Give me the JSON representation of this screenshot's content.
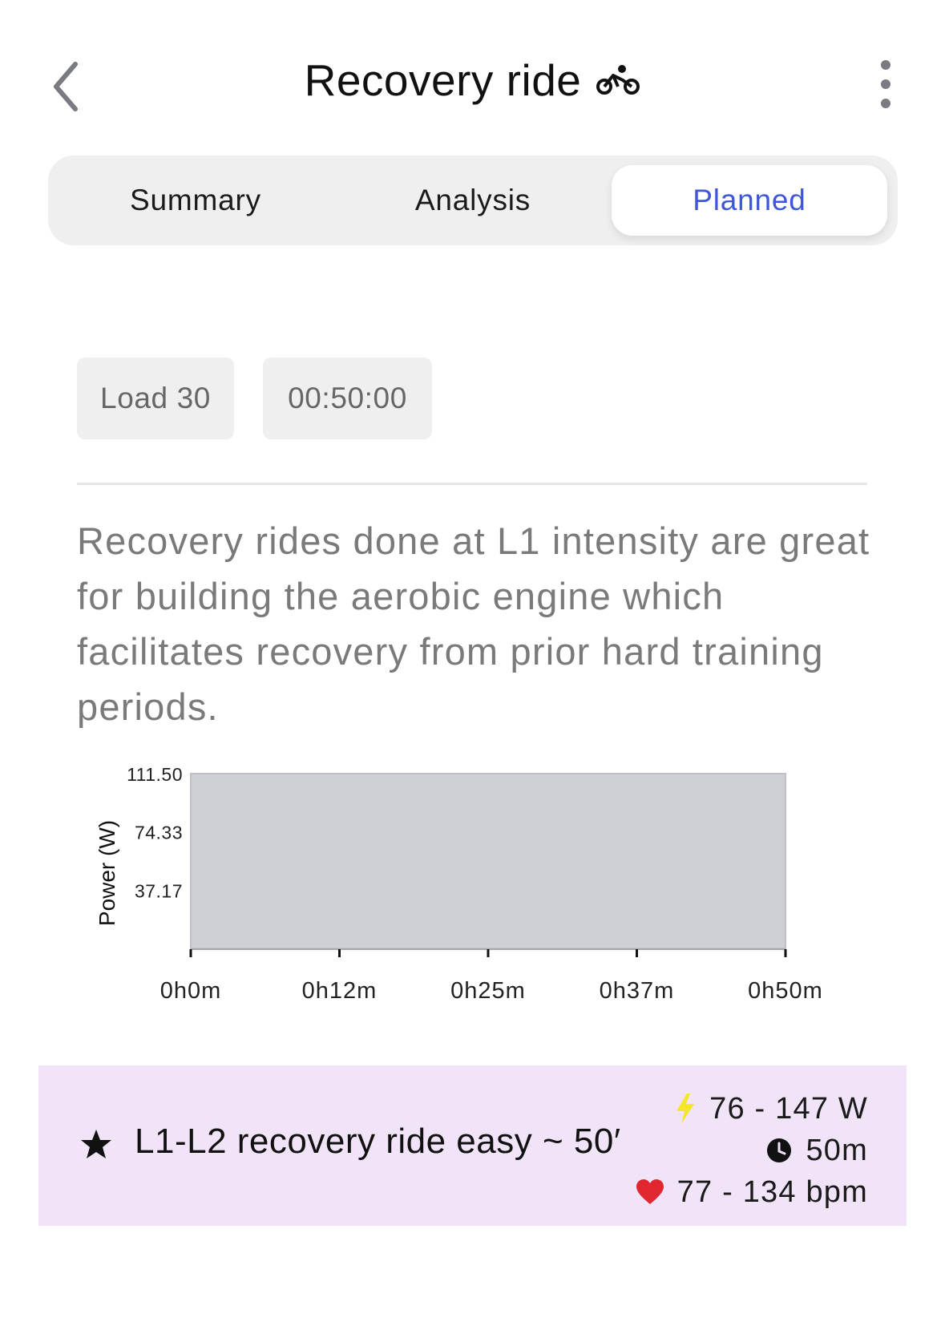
{
  "header": {
    "title": "Recovery ride",
    "sport_icon": "bike-icon",
    "back_icon": "chevron-left-icon",
    "more_icon": "more-vertical-icon"
  },
  "tabs": [
    {
      "label": "Summary",
      "selected": false
    },
    {
      "label": "Analysis",
      "selected": false
    },
    {
      "label": "Planned",
      "selected": true
    }
  ],
  "chips": {
    "load": "Load 30",
    "duration": "00:50:00"
  },
  "description": "Recovery rides done at L1 intensity are great for building the aerobic engine which facilitates recovery from prior hard training periods.",
  "chart_data": {
    "type": "area",
    "ylabel": "Power (W)",
    "xlabel": "",
    "y_ticks": [
      "111.50",
      "74.33",
      "37.17"
    ],
    "x_ticks": [
      "0h0m",
      "0h12m",
      "0h25m",
      "0h37m",
      "0h50m"
    ],
    "ylim": [
      0,
      111.5
    ],
    "xlim": [
      0,
      50
    ],
    "x_unit": "minutes",
    "series": [
      {
        "x": [
          0,
          50
        ],
        "y": [
          111.5,
          111.5
        ]
      }
    ],
    "fill_color": "#cfd0d6",
    "grid": false
  },
  "step": {
    "icon": "star-icon",
    "name": "L1-L2 recovery ride easy ~ 50′",
    "power": "76 - 147 W",
    "duration": "50m",
    "heart_rate": "77 - 134 bpm",
    "colors": {
      "background": "#f1e4f8",
      "power_icon": "#f5e62a",
      "heart_icon": "#e0262e"
    }
  }
}
